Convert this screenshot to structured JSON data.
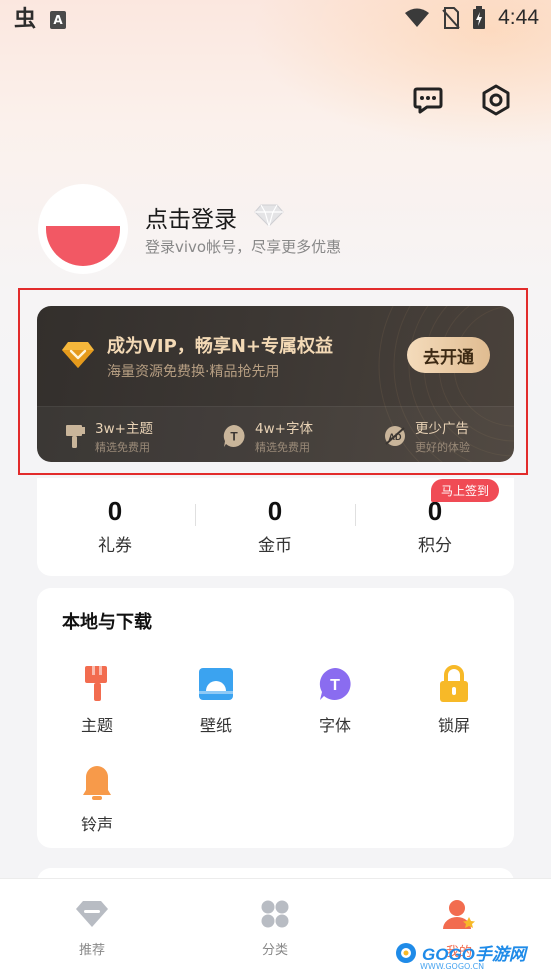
{
  "status_bar": {
    "time": "4:44",
    "bug_glyph": "虫",
    "a_glyph": "A"
  },
  "profile": {
    "title": "点击登录",
    "subtitle": "登录vivo帐号，尽享更多优惠"
  },
  "vip": {
    "title": "成为VIP，畅享N+专属权益",
    "subtitle": "海量资源免费换·精品抢先用",
    "button": "去开通",
    "perks": [
      {
        "title": "3w+主题",
        "sub": "精选免费用",
        "icon": "brush-icon"
      },
      {
        "title": "4w+字体",
        "sub": "精选免费用",
        "icon": "font-icon"
      },
      {
        "title": "更少广告",
        "sub": "更好的体验",
        "icon": "no-ads-icon"
      }
    ]
  },
  "stats": [
    {
      "value": "0",
      "label": "礼券"
    },
    {
      "value": "0",
      "label": "金币"
    },
    {
      "value": "0",
      "label": "积分"
    }
  ],
  "signin_badge": "马上签到",
  "local": {
    "title": "本地与下载",
    "items": [
      {
        "label": "主题",
        "icon": "theme-brush-icon",
        "color": "#f26c4f"
      },
      {
        "label": "壁纸",
        "icon": "wallpaper-icon",
        "color": "#3ba3f0"
      },
      {
        "label": "字体",
        "icon": "font-icon",
        "color": "#8a6cf0"
      },
      {
        "label": "锁屏",
        "icon": "lock-icon",
        "color": "#f7b928"
      },
      {
        "label": "铃声",
        "icon": "bell-icon",
        "color": "#f79a4a"
      }
    ]
  },
  "nav": [
    {
      "label": "推荐",
      "icon": "diamond-icon"
    },
    {
      "label": "分类",
      "icon": "grid-icon"
    },
    {
      "label": "我的",
      "icon": "user-icon"
    }
  ],
  "watermark": {
    "text": "GOGO手游网",
    "sub": "WWW.GOGO.CN"
  },
  "colors": {
    "accent_red": "#f04b55",
    "vip_gold": "#f3d9b5",
    "highlight": "#e22b2b"
  }
}
